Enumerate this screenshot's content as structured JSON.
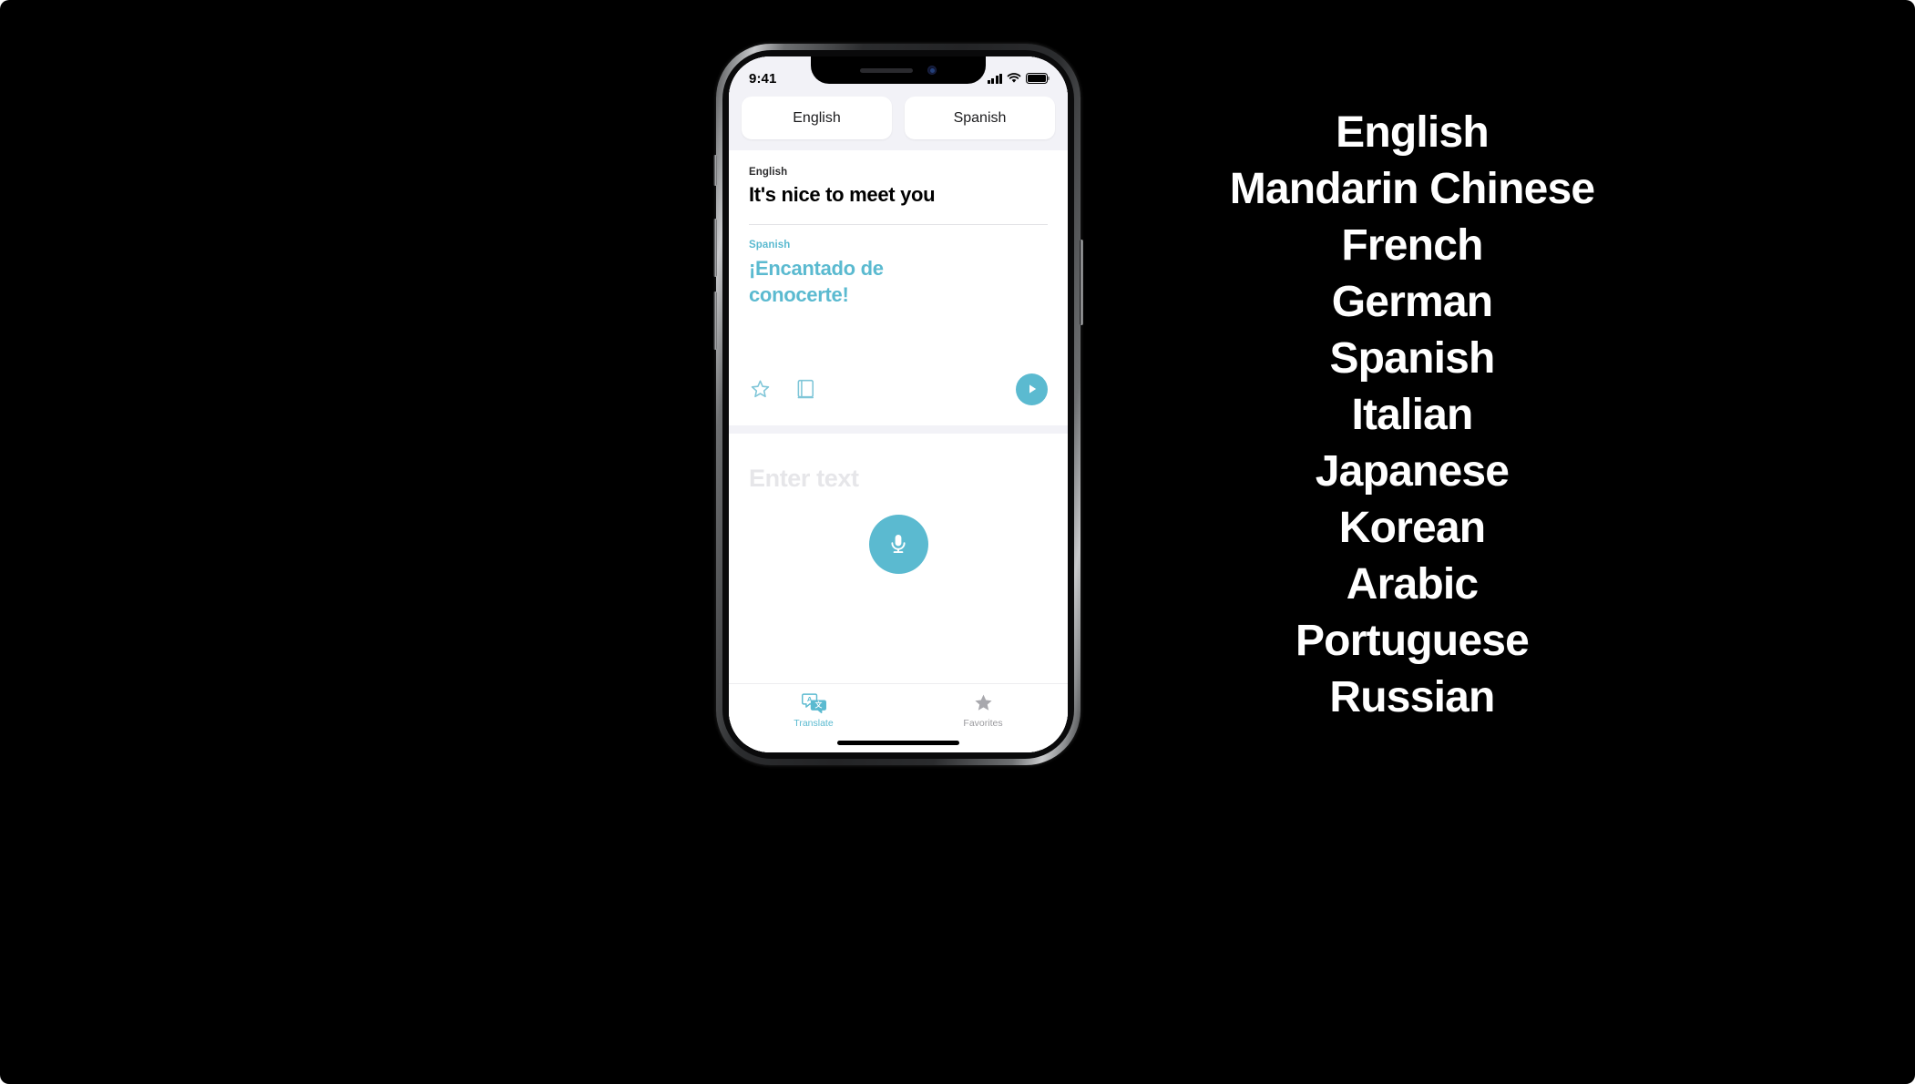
{
  "canvas": {
    "background": "#000000"
  },
  "accent_color": "#5BBAD0",
  "phone": {
    "status_bar": {
      "time": "9:41",
      "cellular_icon": "signal-bars-icon",
      "wifi_icon": "wifi-icon",
      "battery_icon": "battery-full-icon"
    },
    "language_selector": {
      "source_label": "English",
      "target_label": "Spanish"
    },
    "translation_card": {
      "source_language_label": "English",
      "source_text": "It's nice to meet you",
      "target_language_label": "Spanish",
      "target_text": "¡Encantado de conocerte!",
      "actions": {
        "favorite_icon": "star-outline-icon",
        "dictionary_icon": "book-outline-icon",
        "play_icon": "play-icon"
      }
    },
    "input_area": {
      "placeholder": "Enter text",
      "microphone_icon": "microphone-icon"
    },
    "tab_bar": {
      "tabs": [
        {
          "label": "Translate",
          "icon": "translate-bubbles-icon",
          "active": true
        },
        {
          "label": "Favorites",
          "icon": "star-filled-icon",
          "active": false
        }
      ]
    }
  },
  "language_list": {
    "items": [
      "English",
      "Mandarin Chinese",
      "French",
      "German",
      "Spanish",
      "Italian",
      "Japanese",
      "Korean",
      "Arabic",
      "Portuguese",
      "Russian"
    ]
  }
}
